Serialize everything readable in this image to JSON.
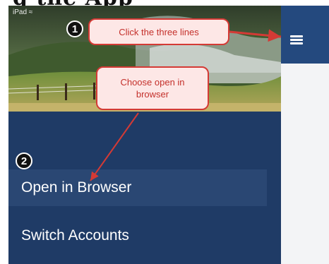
{
  "status_bar": {
    "device_label": "iPad ≈"
  },
  "callouts": {
    "step1_number": "1",
    "step1_text": "Click the three lines",
    "step2_number": "2",
    "step2_text": "Choose open in browser"
  },
  "menu": {
    "items": [
      {
        "label": "Open in Browser"
      },
      {
        "label": "Switch Accounts"
      }
    ]
  },
  "icons": {
    "menu": "hamburger-icon"
  },
  "colors": {
    "nav_background": "#1f3b66",
    "highlight_row": "#2a4773",
    "top_bar": "#24497e",
    "callout_border": "#d43a35",
    "callout_fill": "#fde7e6",
    "callout_text": "#c4302b"
  }
}
